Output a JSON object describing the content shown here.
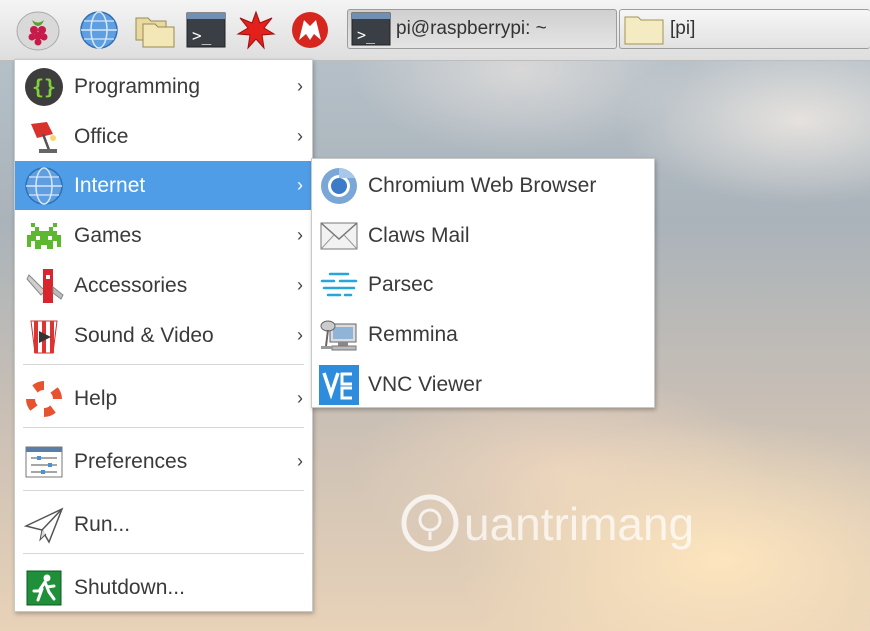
{
  "taskbar": {
    "launchers": [
      {
        "icon": "raspberry-pi-menu-icon"
      },
      {
        "icon": "web-browser-icon"
      },
      {
        "icon": "file-manager-icon"
      },
      {
        "icon": "terminal-icon"
      },
      {
        "icon": "mathematica-icon"
      },
      {
        "icon": "wolfram-icon"
      }
    ],
    "tasks": [
      {
        "label": "pi@raspberrypi: ~",
        "icon": "terminal-icon"
      },
      {
        "label": "[pi]",
        "icon": "folder-icon"
      }
    ]
  },
  "main_menu": {
    "items": [
      {
        "label": "Programming",
        "icon": "programming-icon",
        "has_submenu": true
      },
      {
        "label": "Office",
        "icon": "office-icon",
        "has_submenu": true
      },
      {
        "label": "Internet",
        "icon": "internet-globe-icon",
        "has_submenu": true,
        "selected": true
      },
      {
        "label": "Games",
        "icon": "games-invader-icon",
        "has_submenu": true
      },
      {
        "label": "Accessories",
        "icon": "accessories-knife-icon",
        "has_submenu": true
      },
      {
        "label": "Sound & Video",
        "icon": "sound-video-icon",
        "has_submenu": true
      },
      {
        "label": "Help",
        "icon": "help-lifebuoy-icon",
        "has_submenu": true
      },
      {
        "label": "Preferences",
        "icon": "preferences-icon",
        "has_submenu": true
      },
      {
        "label": "Run...",
        "icon": "run-paper-plane-icon",
        "has_submenu": false
      },
      {
        "label": "Shutdown...",
        "icon": "shutdown-exit-icon",
        "has_submenu": false
      }
    ],
    "arrow_glyph": "›"
  },
  "sub_menu": {
    "items": [
      {
        "label": "Chromium Web Browser",
        "icon": "chromium-icon"
      },
      {
        "label": "Claws Mail",
        "icon": "mail-envelope-icon"
      },
      {
        "label": "Parsec",
        "icon": "parsec-icon"
      },
      {
        "label": "Remmina",
        "icon": "remmina-icon"
      },
      {
        "label": "VNC Viewer",
        "icon": "vnc-viewer-icon"
      }
    ]
  },
  "colors": {
    "selection": "#4e9de6",
    "text": "#3a3a3a"
  },
  "watermark": {
    "text": "uantrimang"
  }
}
